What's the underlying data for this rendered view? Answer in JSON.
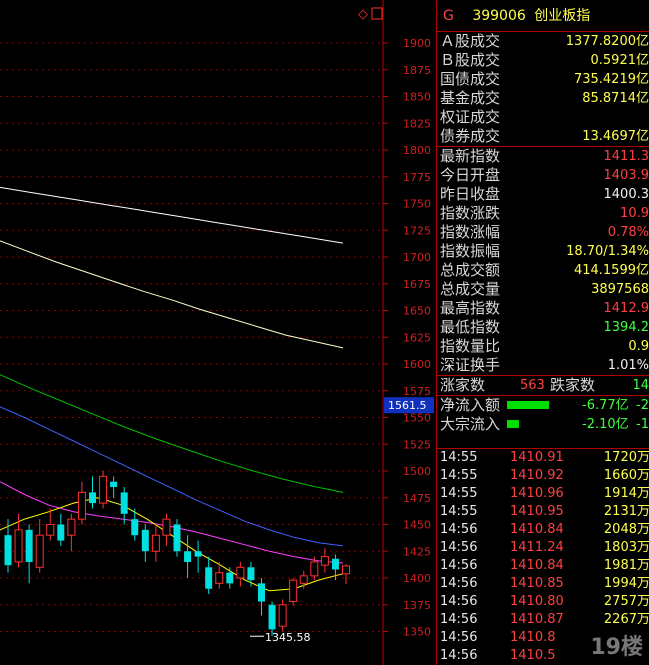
{
  "header": {
    "flag": "G",
    "code": "399006",
    "name": "创业板指"
  },
  "turnover": [
    {
      "label": "Ａ股成交",
      "value": "1377.8200亿"
    },
    {
      "label": "Ｂ股成交",
      "value": "0.5921亿"
    },
    {
      "label": "国债成交",
      "value": "735.4219亿"
    },
    {
      "label": "基金成交",
      "value": "85.8714亿"
    },
    {
      "label": "权证成交",
      "value": ""
    },
    {
      "label": "债券成交",
      "value": "13.4697亿"
    }
  ],
  "stats": [
    {
      "label": "最新指数",
      "value": "1411.3",
      "color": "red"
    },
    {
      "label": "今日开盘",
      "value": "1403.9",
      "color": "red"
    },
    {
      "label": "昨日收盘",
      "value": "1400.3",
      "color": "white"
    },
    {
      "label": "指数涨跌",
      "value": "10.9",
      "color": "red"
    },
    {
      "label": "指数涨幅",
      "value": "0.78%",
      "color": "red"
    },
    {
      "label": "指数振幅",
      "value": "18.70/1.34%",
      "color": "yellow"
    },
    {
      "label": "总成交额",
      "value": "414.1599亿",
      "color": "yellow"
    },
    {
      "label": "总成交量",
      "value": "3897568",
      "color": "yellow"
    },
    {
      "label": "最高指数",
      "value": "1412.9",
      "color": "red"
    },
    {
      "label": "最低指数",
      "value": "1394.2",
      "color": "green"
    },
    {
      "label": "指数量比",
      "value": "0.9",
      "color": "yellow"
    },
    {
      "label": "深证换手",
      "value": "1.01%",
      "color": "white"
    }
  ],
  "breadth": {
    "up_label": "涨家数",
    "up_value": "563",
    "down_label": "跌家数",
    "down_value": "14"
  },
  "flows": [
    {
      "label": "净流入额",
      "value": "-6.77亿",
      "extra": "-2",
      "bar": 0.7
    },
    {
      "label": "大宗流入",
      "value": "-2.10亿",
      "extra": "-1",
      "bar": 0.2
    }
  ],
  "trades": [
    {
      "time": "14:55",
      "price": "1410.91",
      "vol": "1720万"
    },
    {
      "time": "14:55",
      "price": "1410.92",
      "vol": "1660万"
    },
    {
      "time": "14:55",
      "price": "1410.96",
      "vol": "1914万"
    },
    {
      "time": "14:55",
      "price": "1410.95",
      "vol": "2131万"
    },
    {
      "time": "14:56",
      "price": "1410.84",
      "vol": "2048万"
    },
    {
      "time": "14:56",
      "price": "1411.24",
      "vol": "1803万"
    },
    {
      "time": "14:56",
      "price": "1410.84",
      "vol": "1981万"
    },
    {
      "time": "14:56",
      "price": "1410.85",
      "vol": "1994万"
    },
    {
      "time": "14:56",
      "price": "1410.80",
      "vol": "2757万"
    },
    {
      "time": "14:56",
      "price": "1410.87",
      "vol": "2267万"
    },
    {
      "time": "14:56",
      "price": "1410.8",
      "vol": ""
    },
    {
      "time": "14:56",
      "price": "1410.5",
      "vol": ""
    }
  ],
  "watermark": "19楼",
  "chart_data": {
    "type": "candlestick",
    "y_ticks": [
      1900,
      1875,
      1850,
      1825,
      1800,
      1775,
      1750,
      1725,
      1700,
      1675,
      1650,
      1625,
      1600,
      1575,
      1550,
      1525,
      1500,
      1475,
      1450,
      1425,
      1400,
      1375,
      1350
    ],
    "ylim": [
      1330,
      1915
    ],
    "current_price_label": "1561.5",
    "current_price": 1561.5,
    "low_label": "1345.58",
    "low_value": 1345.58,
    "grid": true,
    "candles": [
      [
        1440,
        1412,
        1455,
        1405
      ],
      [
        1415,
        1445,
        1460,
        1410
      ],
      [
        1445,
        1415,
        1450,
        1395
      ],
      [
        1410,
        1440,
        1455,
        1405
      ],
      [
        1440,
        1450,
        1465,
        1435
      ],
      [
        1450,
        1435,
        1460,
        1430
      ],
      [
        1440,
        1455,
        1460,
        1425
      ],
      [
        1455,
        1480,
        1490,
        1450
      ],
      [
        1480,
        1470,
        1495,
        1465
      ],
      [
        1470,
        1495,
        1500,
        1465
      ],
      [
        1490,
        1485,
        1495,
        1475
      ],
      [
        1480,
        1460,
        1485,
        1450
      ],
      [
        1455,
        1440,
        1465,
        1435
      ],
      [
        1445,
        1425,
        1450,
        1415
      ],
      [
        1425,
        1440,
        1450,
        1415
      ],
      [
        1440,
        1455,
        1460,
        1430
      ],
      [
        1450,
        1425,
        1455,
        1420
      ],
      [
        1425,
        1415,
        1440,
        1400
      ],
      [
        1425,
        1420,
        1435,
        1405
      ],
      [
        1410,
        1390,
        1420,
        1385
      ],
      [
        1395,
        1405,
        1415,
        1390
      ],
      [
        1405,
        1395,
        1410,
        1390
      ],
      [
        1400,
        1410,
        1415,
        1392
      ],
      [
        1410,
        1398,
        1415,
        1392
      ],
      [
        1395,
        1378,
        1400,
        1365
      ],
      [
        1375,
        1352,
        1378,
        1345.58
      ],
      [
        1355,
        1375,
        1380,
        1350
      ],
      [
        1378,
        1398,
        1400,
        1374
      ],
      [
        1395,
        1402,
        1407,
        1390
      ],
      [
        1402,
        1415,
        1420,
        1398
      ],
      [
        1412,
        1420,
        1428,
        1405
      ],
      [
        1418,
        1408,
        1422,
        1398
      ],
      [
        1403.9,
        1411.3,
        1412.9,
        1394.2
      ]
    ],
    "ma_lines": [
      {
        "color": "#ffffff",
        "values": [
          1765,
          1761,
          1757,
          1753,
          1749,
          1745,
          1741,
          1737,
          1733,
          1729,
          1725,
          1721,
          1717,
          1713
        ]
      },
      {
        "color": "#ffffcc",
        "values": [
          1715,
          1705,
          1695,
          1686,
          1677,
          1668,
          1660,
          1651,
          1643,
          1635,
          1627,
          1621,
          1615
        ]
      },
      {
        "color": "#00c000",
        "values": [
          1590,
          1577,
          1565,
          1553,
          1541,
          1530,
          1520,
          1510,
          1501,
          1493,
          1486,
          1480
        ]
      },
      {
        "color": "#4060ff",
        "values": [
          1560,
          1550,
          1539,
          1528,
          1517,
          1506,
          1495,
          1484,
          1473,
          1463,
          1453,
          1445,
          1438,
          1433,
          1430
        ]
      },
      {
        "color": "#ff40ff",
        "values": [
          1490,
          1478,
          1468,
          1462,
          1458,
          1455,
          1452,
          1448,
          1443,
          1437,
          1431,
          1425,
          1420,
          1416,
          1414
        ]
      },
      {
        "color": "#ffff00",
        "values": [
          1445,
          1455,
          1462,
          1470,
          1475,
          1468,
          1455,
          1440,
          1425,
          1412,
          1398,
          1388,
          1390,
          1398,
          1404
        ]
      }
    ]
  }
}
